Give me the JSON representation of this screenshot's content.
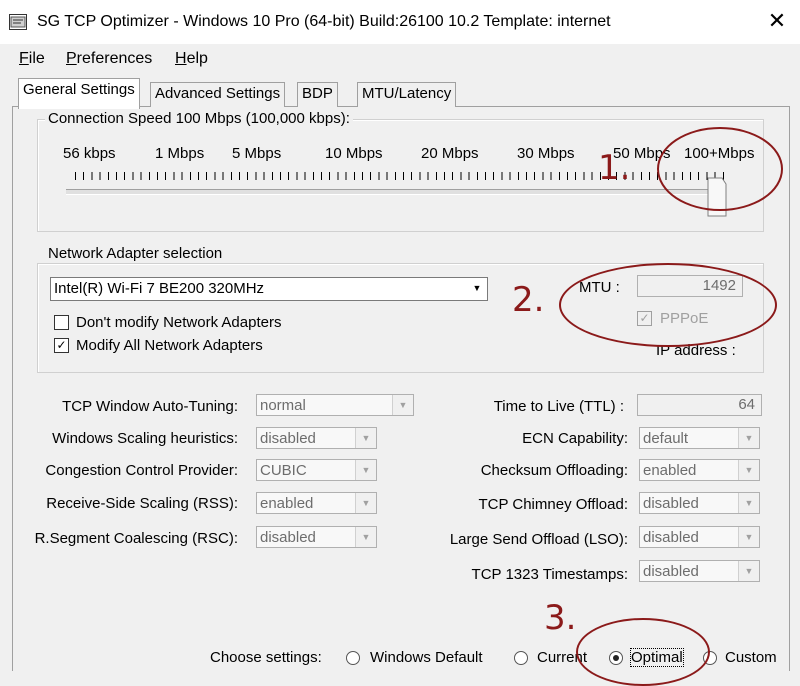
{
  "window": {
    "title": "SG TCP Optimizer - Windows 10 Pro (64-bit) Build:26100 10.2  Template: internet",
    "close_glyph": "✕"
  },
  "menu": [
    "File",
    "Preferences",
    "Help"
  ],
  "tabs": [
    "General Settings",
    "Advanced Settings",
    "BDP",
    "MTU/Latency"
  ],
  "connection_speed": {
    "group_label": "Connection Speed  100 Mbps (100,000 kbps):",
    "ticks": [
      "56 kbps",
      "1 Mbps",
      "5 Mbps",
      "10 Mbps",
      "20 Mbps",
      "30 Mbps",
      "50 Mbps",
      "100+Mbps"
    ],
    "slider_level": 1.0
  },
  "adapter": {
    "group_label": "Network Adapter selection",
    "selected": "Intel(R) Wi-Fi 7 BE200 320MHz",
    "dont_modify": "Don't modify Network Adapters",
    "modify_all": "Modify All Network Adapters",
    "modify_all_checked": true,
    "mtu_label": "MTU :",
    "mtu_value": "1492",
    "pppoe_label": "PPPoE",
    "pppoe_checked": true,
    "ip_label": "IP address :"
  },
  "left_settings": [
    {
      "label": "TCP Window Auto-Tuning:",
      "value": "normal"
    },
    {
      "label": "Windows Scaling heuristics:",
      "value": "disabled"
    },
    {
      "label": "Congestion Control Provider:",
      "value": "CUBIC"
    },
    {
      "label": "Receive-Side Scaling (RSS):",
      "value": "enabled"
    },
    {
      "label": "R.Segment Coalescing (RSC):",
      "value": "disabled"
    }
  ],
  "right_settings": {
    "ttl_label": "Time to Live (TTL) :",
    "ttl_value": "64",
    "items": [
      {
        "label": "ECN Capability:",
        "value": "default"
      },
      {
        "label": "Checksum Offloading:",
        "value": "enabled"
      },
      {
        "label": "TCP Chimney Offload:",
        "value": "disabled"
      },
      {
        "label": "Large Send Offload (LSO):",
        "value": "disabled"
      },
      {
        "label": "TCP 1323 Timestamps:",
        "value": "disabled"
      }
    ]
  },
  "choose": {
    "label": "Choose settings:",
    "options": [
      "Windows Default",
      "Current",
      "Optimal",
      "Custom"
    ],
    "selected": "Optimal"
  },
  "annotations": {
    "one": "1.",
    "two": "2.",
    "three": "3.",
    "color": "#8b1a1a"
  }
}
